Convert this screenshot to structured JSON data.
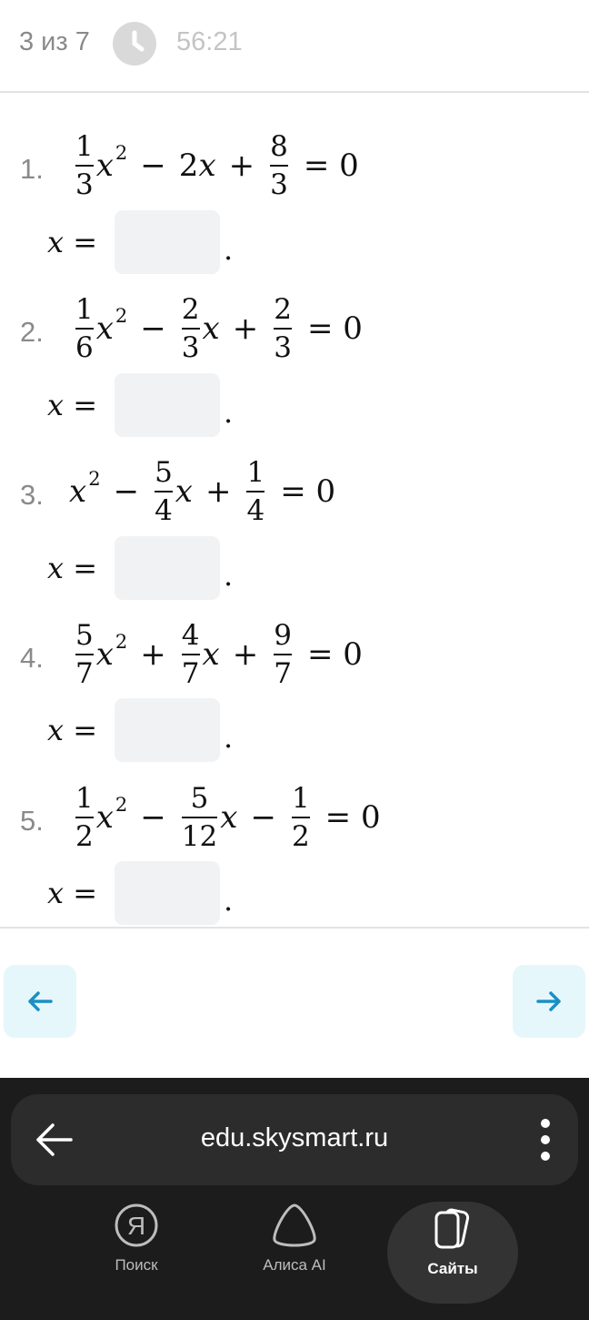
{
  "header": {
    "progress": "3 из 7",
    "timer": "56:21"
  },
  "tasks": [
    {
      "number": "1.",
      "answer_prefix": "x =",
      "answer_value": "",
      "answer_suffix": "."
    },
    {
      "number": "2.",
      "answer_prefix": "x =",
      "answer_value": "",
      "answer_suffix": "."
    },
    {
      "number": "3.",
      "answer_prefix": "x =",
      "answer_value": "",
      "answer_suffix": "."
    },
    {
      "number": "4.",
      "answer_prefix": "x =",
      "answer_value": "",
      "answer_suffix": "."
    },
    {
      "number": "5.",
      "answer_prefix": "x =",
      "answer_value": "",
      "answer_suffix": "."
    }
  ],
  "equations": {
    "e1": {
      "a_num": "1",
      "a_den": "3",
      "x": "x",
      "exp": "2",
      "op1": "−",
      "b": "2",
      "op2": "+",
      "c_num": "8",
      "c_den": "3",
      "eq": "= 0"
    },
    "e2": {
      "a_num": "1",
      "a_den": "6",
      "x": "x",
      "exp": "2",
      "op1": "−",
      "b_num": "2",
      "b_den": "3",
      "op2": "+",
      "c_num": "2",
      "c_den": "3",
      "eq": "= 0"
    },
    "e3": {
      "x": "x",
      "exp": "2",
      "op1": "−",
      "b_num": "5",
      "b_den": "4",
      "op2": "+",
      "c_num": "1",
      "c_den": "4",
      "eq": "= 0"
    },
    "e4": {
      "a_num": "5",
      "a_den": "7",
      "x": "x",
      "exp": "2",
      "op1": "+",
      "b_num": "4",
      "b_den": "7",
      "op2": "+",
      "c_num": "9",
      "c_den": "7",
      "eq": "= 0"
    },
    "e5": {
      "a_num": "1",
      "a_den": "2",
      "x": "x",
      "exp": "2",
      "op1": "−",
      "b_num": "5",
      "b_den": "12",
      "op2": "−",
      "c_num": "1",
      "c_den": "2",
      "eq": "= 0"
    }
  },
  "browser": {
    "url": "edu.skysmart.ru",
    "tabs": [
      {
        "label": "Поиск",
        "icon": "yandex-icon"
      },
      {
        "label": "Алиса AI",
        "icon": "alice-icon"
      },
      {
        "label": "Сайты",
        "icon": "sites-icon"
      }
    ]
  },
  "colors": {
    "accent": "#1a8fc4",
    "nav_bg": "#e6f7fb",
    "input_bg": "#f1f2f4"
  }
}
